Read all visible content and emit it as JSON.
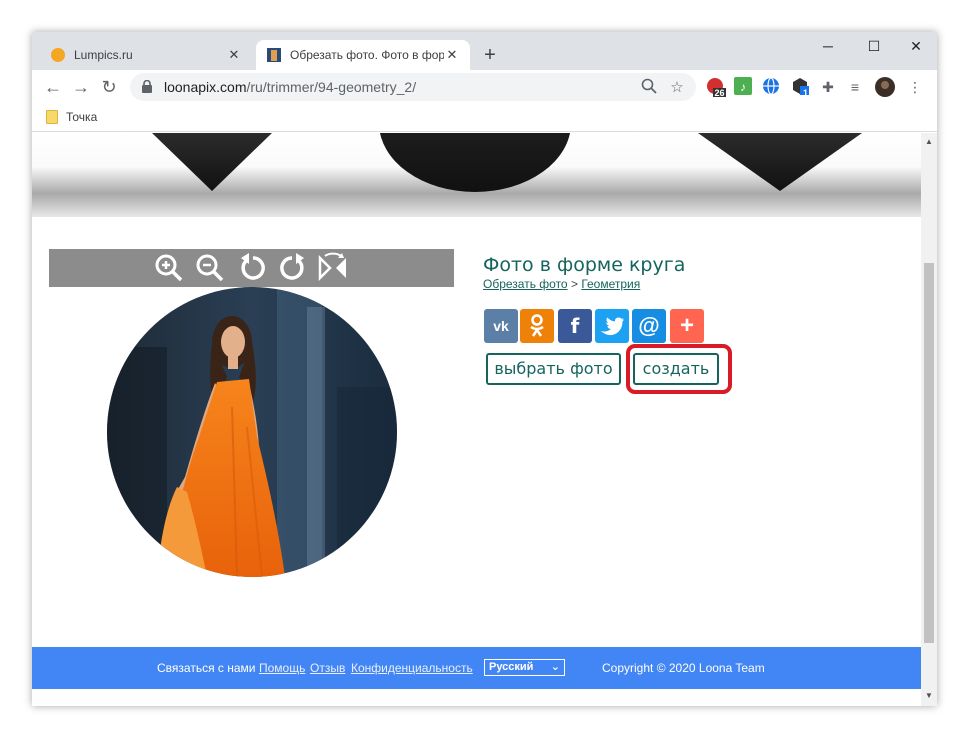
{
  "browser": {
    "tabs": [
      {
        "title": "Lumpics.ru",
        "active": false
      },
      {
        "title": "Обрезать фото. Фото в форме к",
        "active": true
      }
    ],
    "new_tab_label": "+",
    "window_controls": {
      "minimize": "─",
      "maximize": "☐",
      "close": "✕"
    },
    "address": {
      "host": "loonapix.com",
      "path": "/ru/trimmer/94-geometry_2/"
    },
    "extension_badges": {
      "first": "26",
      "second": "1"
    },
    "bookmarks": [
      {
        "label": "Точка"
      }
    ]
  },
  "page": {
    "title": "Фото в форме круга",
    "breadcrumb": {
      "link1": "Обрезать фото",
      "separator": ">",
      "link2": "Геометрия"
    },
    "share_buttons": [
      {
        "name": "vk",
        "glyph": "vk",
        "color": "#5b7fa6"
      },
      {
        "name": "ok",
        "glyph": "ok",
        "color": "#ee8208"
      },
      {
        "name": "facebook",
        "glyph": "f",
        "color": "#3b5998"
      },
      {
        "name": "twitter",
        "glyph": "t",
        "color": "#1da1f2"
      },
      {
        "name": "mail",
        "glyph": "@",
        "color": "#168de2"
      },
      {
        "name": "more",
        "glyph": "+",
        "color": "#ff6550"
      }
    ],
    "choose_photo_label": "выбрать фото",
    "create_label": "создать",
    "editor_tools": [
      "zoom-in-icon",
      "zoom-out-icon",
      "rotate-left-icon",
      "rotate-right-icon",
      "flip-icon"
    ]
  },
  "footer": {
    "contact": "Связаться с нами",
    "help": "Помощь",
    "reviews": "Отзыв",
    "privacy": "Конфиденциальность",
    "language": "Русский",
    "copyright": "Copyright © 2020 Loona Team"
  },
  "colors": {
    "accent": "#16645e",
    "footer": "#4285f4",
    "highlight": "#d71c27"
  }
}
